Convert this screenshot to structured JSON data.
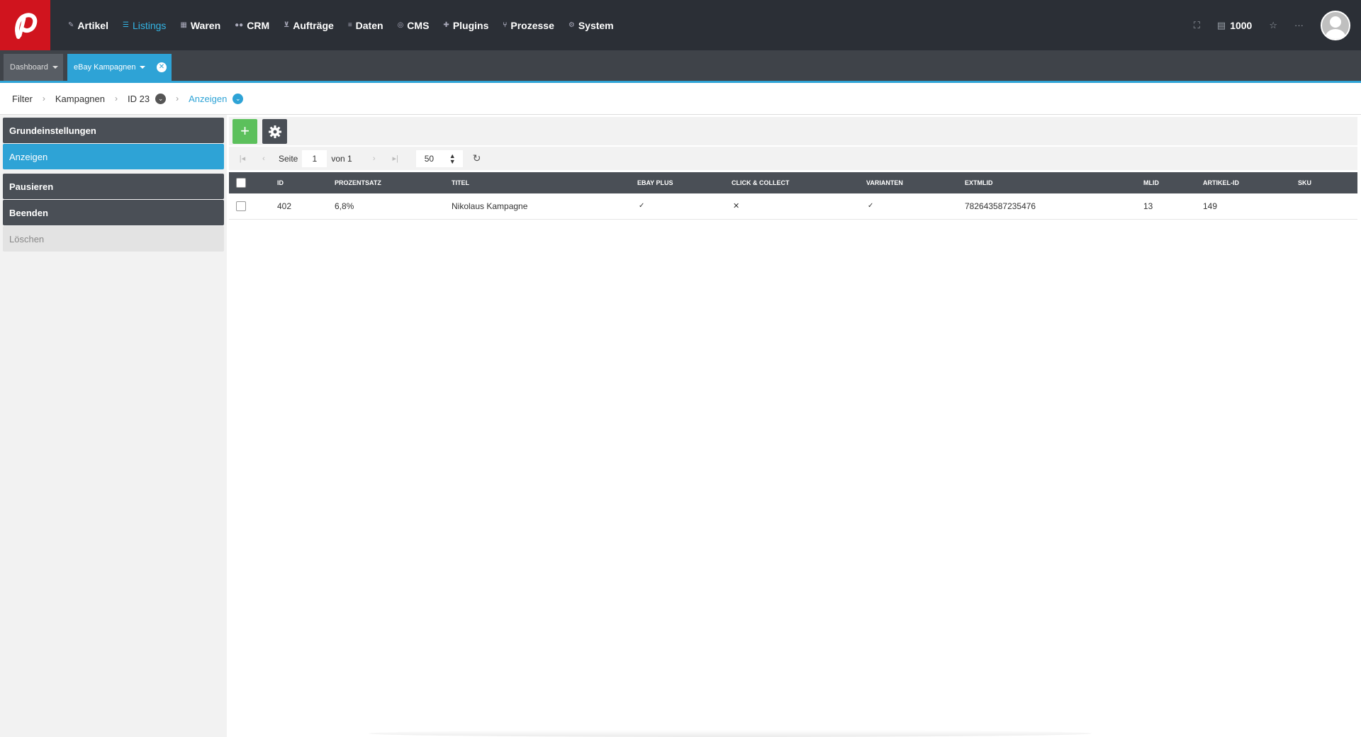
{
  "topbar": {
    "nav": [
      {
        "label": "Artikel",
        "icon": "tag-icon",
        "active": false
      },
      {
        "label": "Listings",
        "icon": "list-icon",
        "active": true
      },
      {
        "label": "Waren",
        "icon": "boxes-icon",
        "active": false
      },
      {
        "label": "CRM",
        "icon": "users-icon",
        "active": false
      },
      {
        "label": "Aufträge",
        "icon": "cart-icon",
        "active": false
      },
      {
        "label": "Daten",
        "icon": "database-icon",
        "active": false
      },
      {
        "label": "CMS",
        "icon": "globe-icon",
        "active": false
      },
      {
        "label": "Plugins",
        "icon": "puzzle-icon",
        "active": false
      },
      {
        "label": "Prozesse",
        "icon": "flow-icon",
        "active": false
      },
      {
        "label": "System",
        "icon": "gear-icon",
        "active": false
      }
    ],
    "credits": "1000"
  },
  "tabs": {
    "dashboard": "Dashboard",
    "ebay": "eBay Kampagnen"
  },
  "breadcrumb": {
    "filter": "Filter",
    "kampagnen": "Kampagnen",
    "id": "ID 23",
    "anzeigen": "Anzeigen"
  },
  "sidebar": {
    "items": [
      {
        "label": "Grundeinstellungen"
      },
      {
        "label": "Anzeigen"
      },
      {
        "label": "Pausieren"
      },
      {
        "label": "Beenden"
      },
      {
        "label": "Löschen"
      }
    ]
  },
  "pager": {
    "seite": "Seite",
    "page": "1",
    "von": "von 1",
    "per_page": "50"
  },
  "table": {
    "headers": [
      "ID",
      "Prozentsatz",
      "Titel",
      "eBay Plus",
      "Click & Collect",
      "Varianten",
      "ExtMlId",
      "MlId",
      "Artikel-ID",
      "SKU"
    ],
    "rows": [
      {
        "id": "402",
        "prozentsatz": "6,8%",
        "titel": "Nikolaus Kampagne",
        "ebay_plus": "✓",
        "click_collect": "✕",
        "varianten": "✓",
        "extmlid": "782643587235476",
        "mlid": "13",
        "artikel_id": "149",
        "sku": ""
      }
    ]
  },
  "colors": {
    "accent": "#2ea3d6",
    "brand": "#d0141e",
    "add": "#5cc05c",
    "dark": "#2b2f36"
  }
}
